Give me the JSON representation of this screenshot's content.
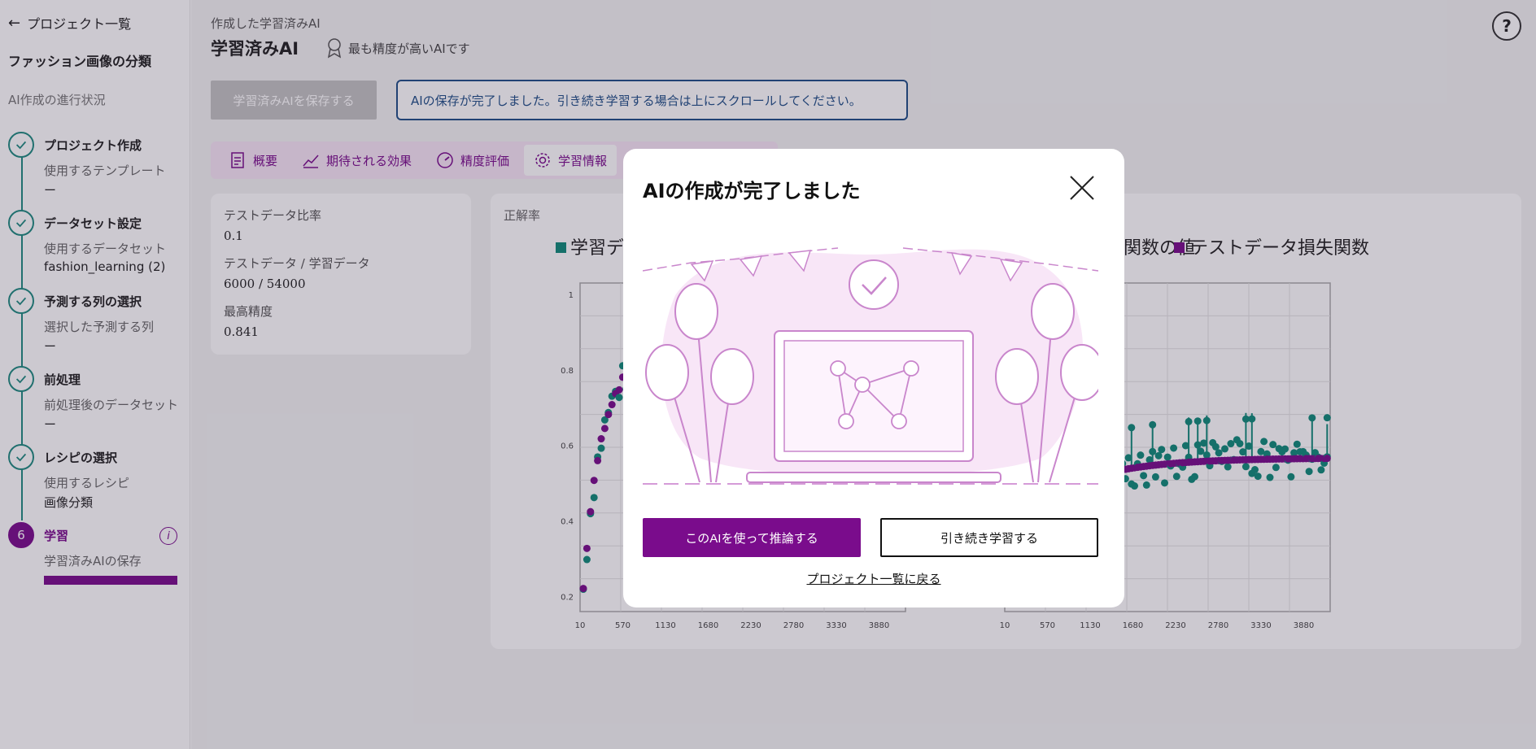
{
  "sidebar": {
    "back_label": "プロジェクト一覧",
    "project_name": "ファッション画像の分類",
    "progress_label": "AI作成の進行状況",
    "steps": [
      {
        "title": "プロジェクト作成",
        "sub": "使用するテンプレート",
        "value": "ー"
      },
      {
        "title": "データセット設定",
        "sub": "使用するデータセット",
        "value": "fashion_learning (2)"
      },
      {
        "title": "予測する列の選択",
        "sub": "選択した予測する列",
        "value": "ー"
      },
      {
        "title": "前処理",
        "sub": "前処理後のデータセット",
        "value": "ー"
      },
      {
        "title": "レシピの選択",
        "sub": "使用するレシピ",
        "value": "画像分類"
      },
      {
        "title": "学習",
        "number": "6",
        "sub": "学習済みAIの保存",
        "value": ""
      }
    ],
    "progress": 1.0
  },
  "header": {
    "crumb": "作成した学習済みAI",
    "title": "学習済みAI",
    "best_badge": "最も精度が高いAIです",
    "save_button": "学習済みAIを保存する",
    "notice": "AIの保存が完了しました。引き続き学習する場合は上にスクロールしてください。",
    "help": "?"
  },
  "tabs": [
    {
      "label": "概要",
      "icon": "document-icon"
    },
    {
      "label": "期待される効果",
      "icon": "trend-icon"
    },
    {
      "label": "精度評価",
      "icon": "gauge-icon"
    },
    {
      "label": "学習情報",
      "icon": "gear-icon"
    }
  ],
  "info": {
    "test_ratio_label": "テストデータ比率",
    "test_ratio_value": "0.1",
    "split_label": "テストデータ / 学習データ",
    "split_value": "6000 / 54000",
    "best_label": "最高精度",
    "best_value": "0.841"
  },
  "chart_card": {
    "title": "正解率",
    "legend_left": "学習デ",
    "legend_right_1": "データ損失関数の値",
    "legend_right_2": "テストデータ損失関数"
  },
  "chart_data": [
    {
      "type": "scatter",
      "x_ticks": [
        "10",
        "570",
        "1130",
        "1680",
        "2230",
        "2780",
        "3330",
        "3880"
      ],
      "y_ticks": [
        "0.2",
        "0.4",
        "0.6",
        "0.8",
        "1"
      ],
      "ylim": [
        0.2,
        1.0
      ],
      "series": [
        {
          "color": "#0f8a7a"
        },
        {
          "color": "#7a0c8c"
        }
      ]
    },
    {
      "type": "scatter",
      "x_ticks": [
        "10",
        "570",
        "1130",
        "1680",
        "2230",
        "2780",
        "3330",
        "3880"
      ],
      "series": [
        {
          "name": "データ損失関数の値",
          "color": "#0f8a7a"
        },
        {
          "name": "テストデータ損失関数",
          "color": "#7a0c8c"
        }
      ]
    }
  ],
  "modal": {
    "title": "AIの作成が完了しました",
    "primary": "このAIを使って推論する",
    "secondary": "引き続き学習する",
    "link": "プロジェクト一覧に戻る"
  },
  "colors": {
    "brand": "#7a0c8c",
    "teal": "#1f8a80",
    "notice": "#1f4e87"
  }
}
